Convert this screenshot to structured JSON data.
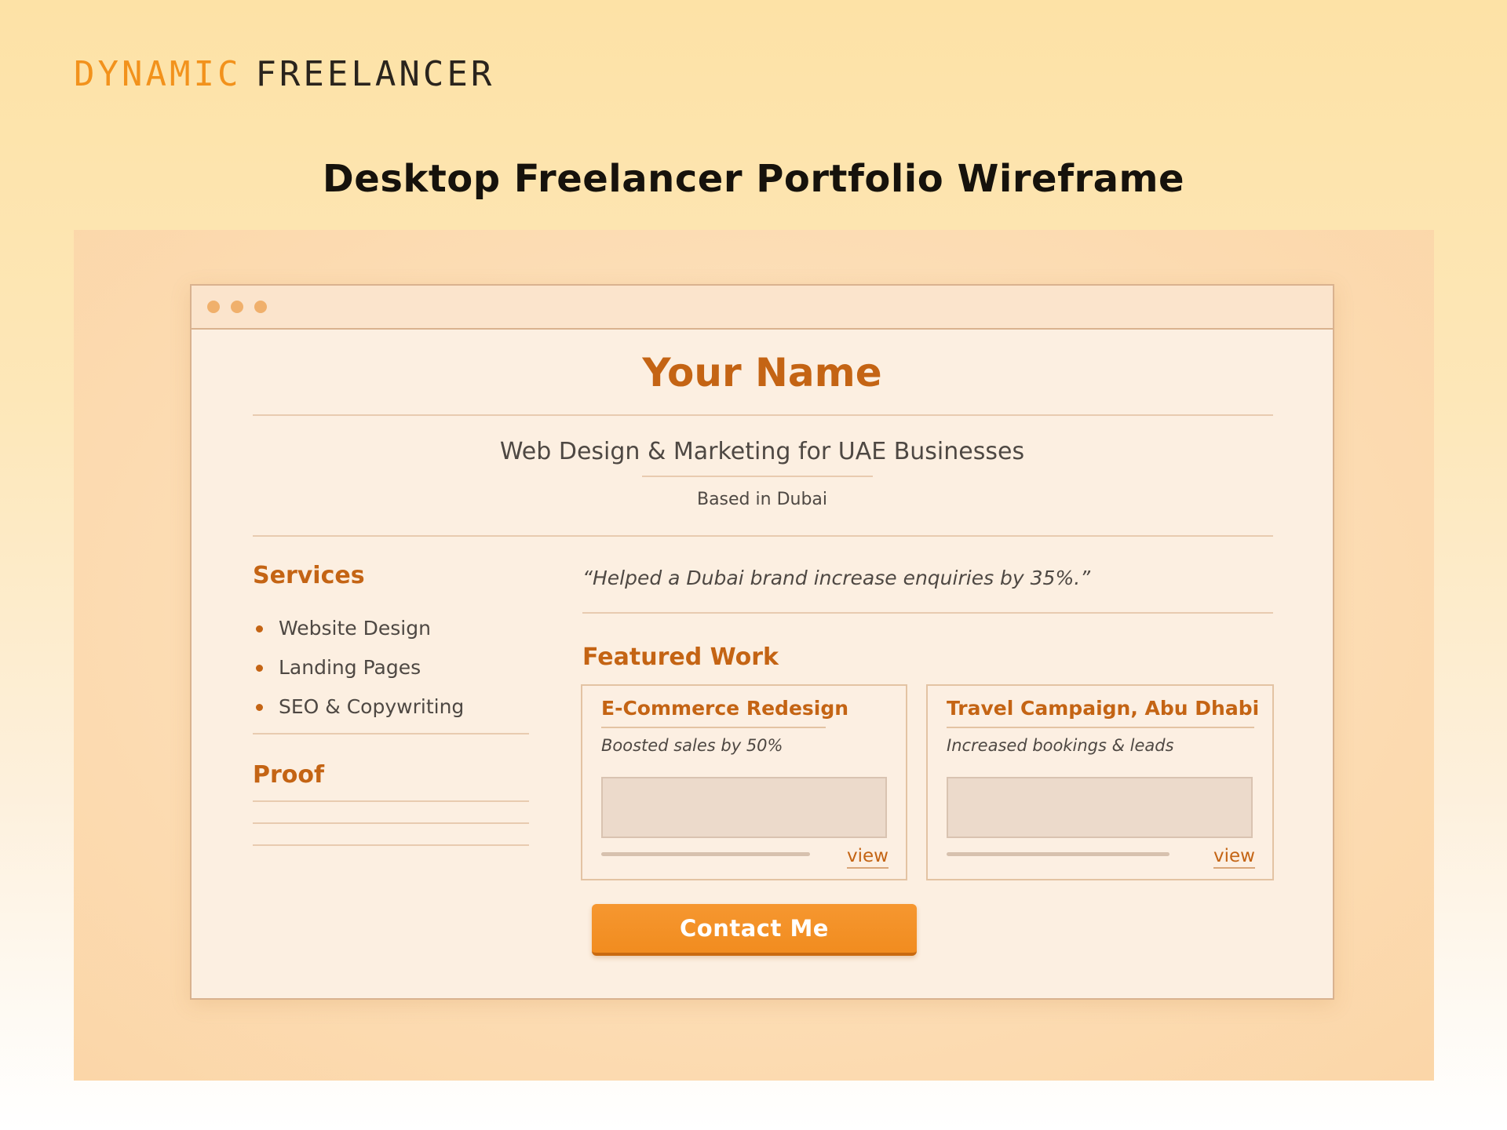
{
  "brand": {
    "word1": "DYNAMIC",
    "word2": "FREELANCER",
    "accent_color": "#f2921c",
    "dark_color": "#2a241d"
  },
  "page": {
    "title": "Desktop Freelancer Portfolio Wireframe"
  },
  "browser": {
    "window_dots": [
      "dot",
      "dot",
      "dot"
    ],
    "hero": {
      "name": "Your Name",
      "tagline": "Web Design & Marketing for UAE Businesses",
      "location": "Based in Dubai"
    },
    "services": {
      "heading": "Services",
      "items": [
        "Website Design",
        "Landing Pages",
        "SEO & Copywriting"
      ]
    },
    "proof": {
      "heading": "Proof"
    },
    "testimonial": "“Helped a Dubai brand increase enquiries by 35%.”",
    "featured_work": {
      "heading": "Featured Work",
      "cards": [
        {
          "title": "E-Commerce Redesign",
          "description": "Boosted sales by 50%",
          "link_label": "view"
        },
        {
          "title": "Travel Campaign, Abu Dhabi",
          "description": "Increased bookings & leads",
          "link_label": "view"
        }
      ]
    },
    "cta": {
      "label": "Contact Me",
      "color": "#f18c1f"
    }
  }
}
